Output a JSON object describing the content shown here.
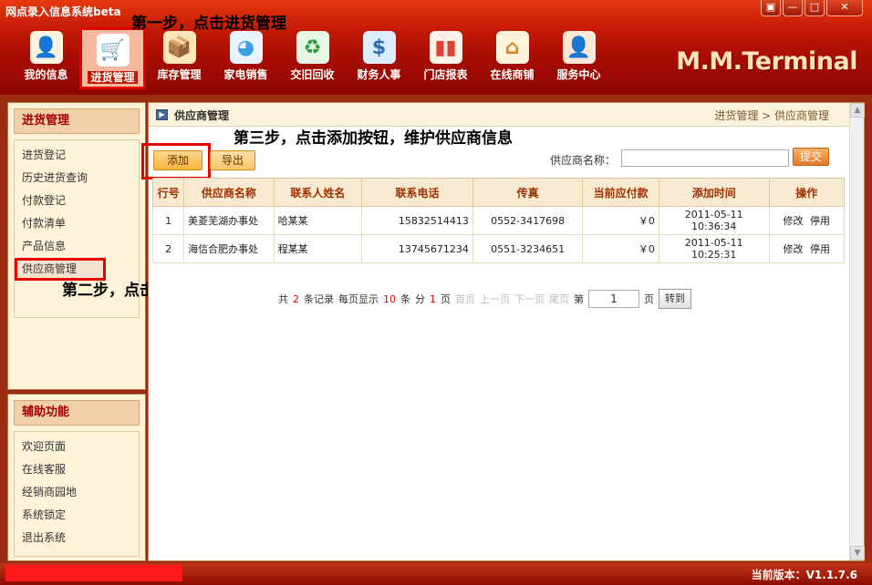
{
  "app": {
    "title": "网点录入信息系统beta",
    "brand": "M.M.Terminal"
  },
  "window_buttons": [
    "▣",
    "—",
    "□",
    "✕"
  ],
  "toolbar": [
    {
      "label": "我的信息",
      "icon": "user-icon",
      "glyph": "👤",
      "color": "#3a70c0"
    },
    {
      "label": "进货管理",
      "icon": "shopping-cart-icon",
      "glyph": "🛒",
      "color": "#f07a10"
    },
    {
      "label": "库存管理",
      "icon": "boxes-icon",
      "glyph": "📦",
      "color": "#e05030"
    },
    {
      "label": "家电销售",
      "icon": "pie-chart-icon",
      "glyph": "◕",
      "color": "#3aa0e0"
    },
    {
      "label": "交旧回收",
      "icon": "recycle-icon",
      "glyph": "♻",
      "color": "#2a9a3a"
    },
    {
      "label": "财务人事",
      "icon": "finance-card-icon",
      "glyph": "$",
      "color": "#2a70b0"
    },
    {
      "label": "门店报表",
      "icon": "bar-chart-icon",
      "glyph": "▮",
      "color": "#e04030"
    },
    {
      "label": "在线商铺",
      "icon": "shop-house-icon",
      "glyph": "⌂",
      "color": "#e08020"
    },
    {
      "label": "服务中心",
      "icon": "service-agent-icon",
      "glyph": "👤",
      "color": "#d06020"
    }
  ],
  "steps": {
    "one": "第一步，点击进货管理",
    "two": "第二步，点击供应商管理",
    "three": "第三步，点击添加按钮，维护供应商信息"
  },
  "sidebar": {
    "section1": {
      "title": "进货管理",
      "items": [
        "进货登记",
        "历史进货查询",
        "付款登记",
        "付款清单",
        "产品信息",
        "供应商管理"
      ]
    },
    "section2": {
      "title": "辅助功能",
      "items": [
        "欢迎页面",
        "在线客服",
        "经销商园地",
        "系统锁定",
        "退出系统"
      ]
    }
  },
  "main": {
    "title": "供应商管理",
    "breadcrumb": "进货管理 > 供应商管理",
    "add_label": "添加",
    "export_label": "导出",
    "search_label": "供应商名称：",
    "search_value": "",
    "submit_label": "提交"
  },
  "table": {
    "headers": [
      "行号",
      "供应商名称",
      "联系人姓名",
      "联系电话",
      "传真",
      "当前应付款",
      "添加时间",
      "操作"
    ],
    "rows": [
      {
        "no": "1",
        "name": "美菱芜湖办事处",
        "contact": "哈某某",
        "phone": "15832514413",
        "fax": "0552-3417698",
        "payable": "￥0",
        "time": "2011-05-11 10:36:34",
        "edit": "修改",
        "disable": "停用"
      },
      {
        "no": "2",
        "name": "海信合肥办事处",
        "contact": "程某某",
        "phone": "13745671234",
        "fax": "0551-3234651",
        "payable": "￥0",
        "time": "2011-05-11 10:25:31",
        "edit": "修改",
        "disable": "停用"
      }
    ]
  },
  "pager": {
    "total_prefix": "共",
    "total": "2",
    "total_suffix": "条记录",
    "per_page_prefix": "每页显示",
    "per_page": "10",
    "per_page_suffix": "条",
    "pages_prefix": "分",
    "pages": "1",
    "pages_suffix": "页",
    "first": "首页",
    "prev": "上一页",
    "next": "下一页",
    "last": "尾页",
    "goto_prefix": "第",
    "current": "1",
    "goto_suffix": "页",
    "go": "转到"
  },
  "status": {
    "version": "当前版本：V1.1.7.6"
  }
}
